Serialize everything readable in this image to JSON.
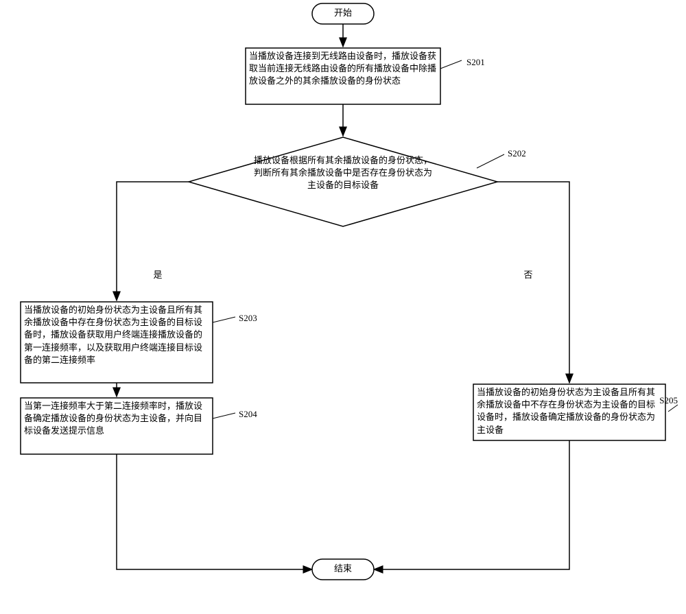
{
  "terminals": {
    "start": "开始",
    "end": "结束"
  },
  "steps": {
    "s201": {
      "label": "S201",
      "text": "当播放设备连接到无线路由设备时，播放设备获取当前连接无线路由设备的所有播放设备中除播放设备之外的其余播放设备的身份状态"
    },
    "s202": {
      "label": "S202",
      "text": "播放设备根据所有其余播放设备的身份状态，判断所有其余播放设备中是否存在身份状态为主设备的目标设备"
    },
    "s203": {
      "label": "S203",
      "text": "当播放设备的初始身份状态为主设备且所有其余播放设备中存在身份状态为主设备的目标设备时，播放设备获取用户终端连接播放设备的第一连接频率，以及获取用户终端连接目标设备的第二连接频率"
    },
    "s204": {
      "label": "S204",
      "text": "当第一连接频率大于第二连接频率时，播放设备确定播放设备的身份状态为主设备，并向目标设备发送提示信息"
    },
    "s205": {
      "label": "S205",
      "text": "当播放设备的初始身份状态为主设备且所有其余播放设备中不存在身份状态为主设备的目标设备时，播放设备确定播放设备的身份状态为主设备"
    }
  },
  "branches": {
    "yes": "是",
    "no": "否"
  }
}
